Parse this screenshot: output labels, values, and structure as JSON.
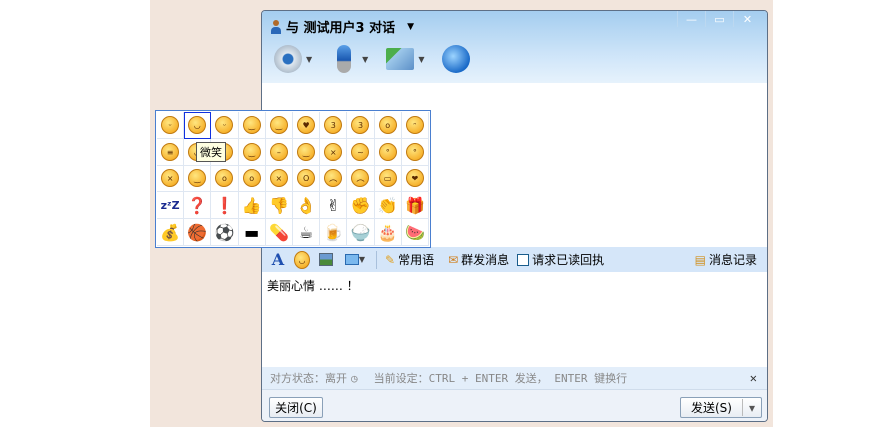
{
  "window": {
    "title": "与 测试用户3 对话",
    "minimize": "—",
    "maximize": "▭",
    "close": "✕"
  },
  "toolbar": [
    {
      "name": "video-icon",
      "color": "#6aa8d8"
    },
    {
      "name": "microphone-icon",
      "color": "#4a88d0"
    },
    {
      "name": "file-transfer-icon",
      "color": "#5cb85c"
    },
    {
      "name": "remote-assist-icon",
      "color": "#3a8ad8"
    }
  ],
  "format_bar": {
    "font_icon": "A",
    "quick_phrases": "常用语",
    "group_send": "群发消息",
    "read_receipt": "请求已读回执",
    "history": "消息记录"
  },
  "input_text": "美丽心情 …… ！",
  "status": {
    "peer": "对方状态：离开",
    "setting": "当前设定：CTRL + ENTER 发送， ENTER 键换行",
    "close": "✕"
  },
  "buttons": {
    "close": "关闭(C)",
    "send": "发送(S)",
    "send_menu": "▾"
  },
  "emoji_panel": {
    "tooltip": "微笑",
    "cells": [
      "ᵕ",
      "◡",
      "ᵕ",
      "‿",
      "‿",
      "♥",
      "3",
      "3",
      "o",
      "ᵔ",
      "≡",
      "◡",
      "ᵕ",
      "‿",
      "–",
      "‿",
      "×",
      "~",
      "°",
      "°",
      "×",
      "‿",
      "o",
      "o",
      "×",
      "O",
      "︵",
      "︵",
      "▭",
      "❤",
      "zᶻZ",
      "❓",
      "❗",
      "👍",
      "👎",
      "👌",
      "✌",
      "✊",
      "👏",
      "🎁",
      "💰",
      "🏀",
      "⚽",
      "▬",
      "💊",
      "☕",
      "🍺",
      "🍚",
      "🎂",
      "🍉"
    ]
  }
}
